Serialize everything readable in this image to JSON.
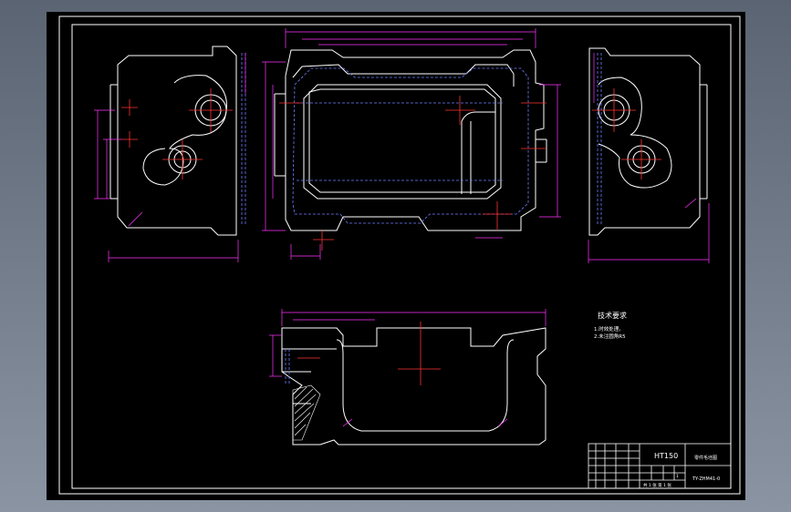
{
  "drawing": {
    "material": "HT150",
    "drawing_title": "零件毛坯图",
    "drawing_number": "TY-ZHM41-0",
    "tech_requirements": {
      "heading": "技术要求",
      "items": [
        "1.时效处理。",
        "2.未注圆角R5"
      ]
    },
    "title_block": {
      "scale": "1",
      "sheet": "共 1 张 第 1 张"
    }
  },
  "colors": {
    "background": "#000000",
    "outline": "#ffffff",
    "dimension": "#ff33ff",
    "centerline": "#ff3333",
    "hidden": "#6f7dff",
    "window": "#7a8595"
  }
}
